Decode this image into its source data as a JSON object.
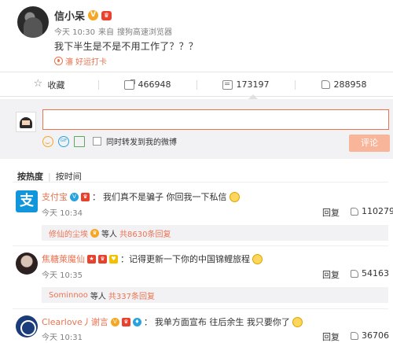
{
  "post": {
    "author": "信小呆",
    "time": "今天 10:30",
    "source_prefix": "来自",
    "source": "搜狗高速浏览器",
    "text": "我下半生是不是不用工作了？？？",
    "tag_prefix": "瀋",
    "tag": "好运打卡"
  },
  "actions": {
    "favorite": "收藏",
    "share_count": "466948",
    "comment_count": "173197",
    "like_count": "288958"
  },
  "composer": {
    "input_value": "",
    "sync_label": "同时转发到我的微博",
    "submit_label": "评论"
  },
  "sort": {
    "hot": "按热度",
    "time": "按时间"
  },
  "comments": [
    {
      "name": "支付宝",
      "text": "我们真不是骗子 你回我一下私信",
      "time": "今天 10:34",
      "reply": "回复",
      "likes": "110279",
      "sub": {
        "name": "修仙的尘埃",
        "mid": "等人",
        "link": "共8630条回复"
      }
    },
    {
      "name": "焦糖萊魔仙",
      "text": "：记得更新一下你的中国锦鲤旅程",
      "time": "今天 10:35",
      "reply": "回复",
      "likes": "54163",
      "sub": {
        "name": "Sominnoo",
        "mid": "等人",
        "link": "共337条回复"
      }
    },
    {
      "name": "Clearlove丿谢言",
      "text": "我单方面宣布 往后余生 我只要你了",
      "time": "今天 10:31",
      "reply": "回复",
      "likes": "36706"
    }
  ],
  "icons": {
    "alipay_glyph": "支",
    "verified_glyph": "V"
  },
  "colors": {
    "accent": "#eb7350",
    "link_blue": "#29a3e0",
    "composer_bg": "#f2f2f5"
  }
}
